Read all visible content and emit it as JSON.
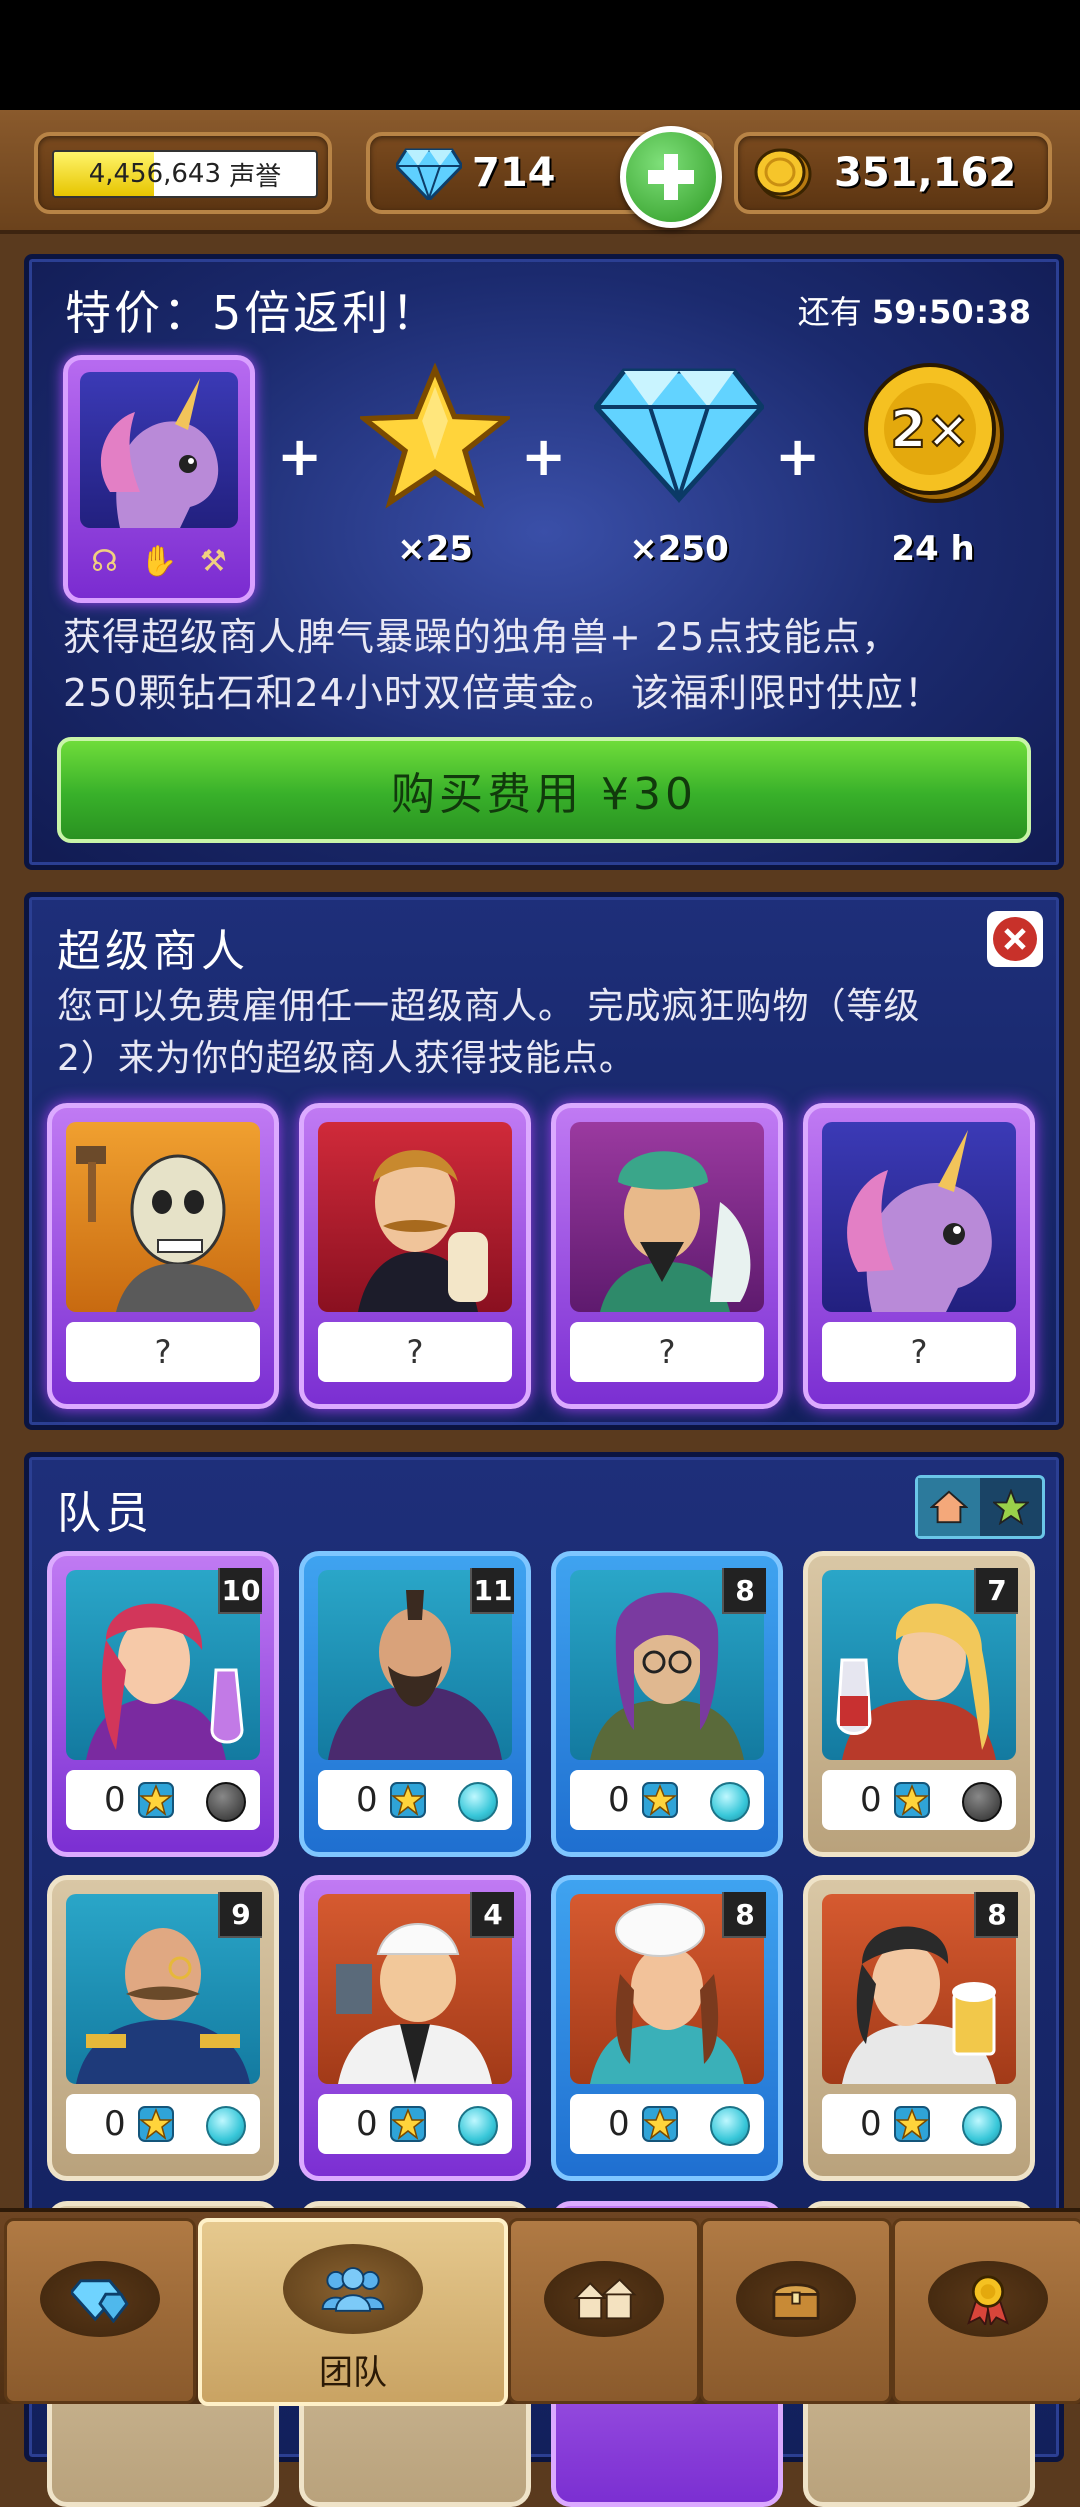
{
  "topbar": {
    "reputation": {
      "value": "4,456,643",
      "unit": "声誉",
      "progress_fraction": 0.38
    },
    "gems": "714",
    "gold": "351,162"
  },
  "offer": {
    "title": "特价：5倍返利！",
    "timer_label": "还有",
    "timer_value": "59:50:38",
    "rewards": [
      {
        "icon": "star-icon",
        "count": "×25"
      },
      {
        "icon": "diamond-icon",
        "count": "×250"
      },
      {
        "icon": "double-gold-coin-icon",
        "badge": "2×",
        "count": "24 h"
      }
    ],
    "description_line1": "获得超级商人脾气暴躁的独角兽+ 25点技能点，",
    "description_line2": "250颗钻石和24小时双倍黄金。 该福利限时供应！",
    "buy_label": "购买费用 ¥30"
  },
  "hire": {
    "title": "超级商人",
    "description_line1": "您可以免费雇佣任一超级商人。 完成疯狂购物（等级",
    "description_line2": "2）来为你的超级商人获得技能点。",
    "merchants": [
      {
        "name": "skeleton-merchant",
        "label": "?"
      },
      {
        "name": "gentleman-merchant",
        "label": "?"
      },
      {
        "name": "turban-merchant",
        "label": "?"
      },
      {
        "name": "unicorn-merchant",
        "label": "?"
      }
    ]
  },
  "team": {
    "title": "队员",
    "members": [
      {
        "level": "10",
        "skill": "0",
        "status": "busy",
        "frame": "purple"
      },
      {
        "level": "11",
        "skill": "0",
        "status": "ready",
        "frame": "blue"
      },
      {
        "level": "8",
        "skill": "0",
        "status": "ready",
        "frame": "blue"
      },
      {
        "level": "7",
        "skill": "0",
        "status": "busy",
        "frame": "tan"
      },
      {
        "level": "9",
        "skill": "0",
        "status": "ready",
        "frame": "tan"
      },
      {
        "level": "4",
        "skill": "0",
        "status": "ready",
        "frame": "purple"
      },
      {
        "level": "8",
        "skill": "0",
        "status": "ready",
        "frame": "blue"
      },
      {
        "level": "8",
        "skill": "0",
        "status": "ready",
        "frame": "tan"
      }
    ]
  },
  "nav": {
    "items": [
      {
        "icon": "gems-icon",
        "label": ""
      },
      {
        "icon": "team-icon",
        "label": "团队"
      },
      {
        "icon": "shop-icon",
        "label": ""
      },
      {
        "icon": "treasure-chest-icon",
        "label": ""
      },
      {
        "icon": "medal-icon",
        "label": ""
      }
    ]
  }
}
